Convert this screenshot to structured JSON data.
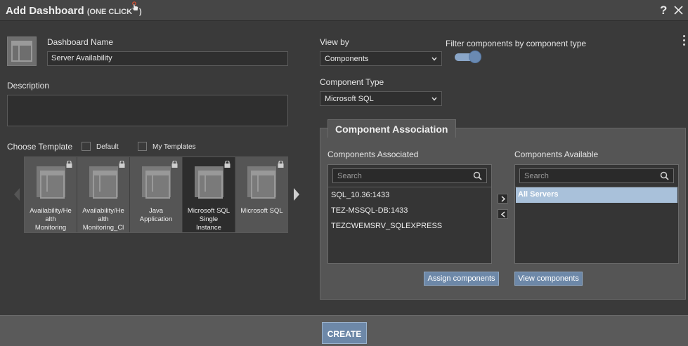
{
  "window": {
    "title": "Add Dashboard",
    "subtitle": "(ONE CLICK",
    "subtitle_end": ")",
    "help": "?"
  },
  "form": {
    "name_label": "Dashboard Name",
    "name_value": "Server Availability",
    "description_label": "Description",
    "description_value": "",
    "view_by_label": "View by",
    "view_by_value": "Components",
    "filter_label": "Filter components by component type",
    "filter_enabled": true,
    "component_type_label": "Component Type",
    "component_type_value": "Microsoft SQL"
  },
  "templates": {
    "label": "Choose Template",
    "default_label": "Default",
    "my_templates_label": "My Templates",
    "items": [
      {
        "name": "Availability/Health Monitoring",
        "lines": [
          "Availability/He",
          "alth",
          "Monitoring"
        ],
        "selected": false
      },
      {
        "name": "Availability/Health Monitoring_Cl",
        "lines": [
          "Availability/He",
          "alth",
          "Monitoring_Cl"
        ],
        "selected": false
      },
      {
        "name": "Java Application",
        "lines": [
          "Java",
          "Application"
        ],
        "selected": false
      },
      {
        "name": "Microsoft SQL Single Instance",
        "lines": [
          "Microsoft SQL",
          "Single",
          "Instance"
        ],
        "selected": true
      },
      {
        "name": "Microsoft SQL",
        "lines": [
          "Microsoft SQL"
        ],
        "selected": false
      }
    ]
  },
  "association": {
    "title": "Component Association",
    "associated_label": "Components Associated",
    "available_label": "Components Available",
    "search_placeholder": "Search",
    "associated_items": [
      "SQL_10.36:1433",
      "TEZ-MSSQL-DB:1433",
      "TEZCWEMSRV_SQLEXPRESS"
    ],
    "available_items": [
      "All Servers"
    ],
    "assign_button": "Assign components",
    "view_button": "View components"
  },
  "footer": {
    "create_button": "CREATE"
  },
  "colors": {
    "accent": "#6d88a8",
    "highlight": "#a9c1da",
    "background": "#3a3a3a"
  }
}
